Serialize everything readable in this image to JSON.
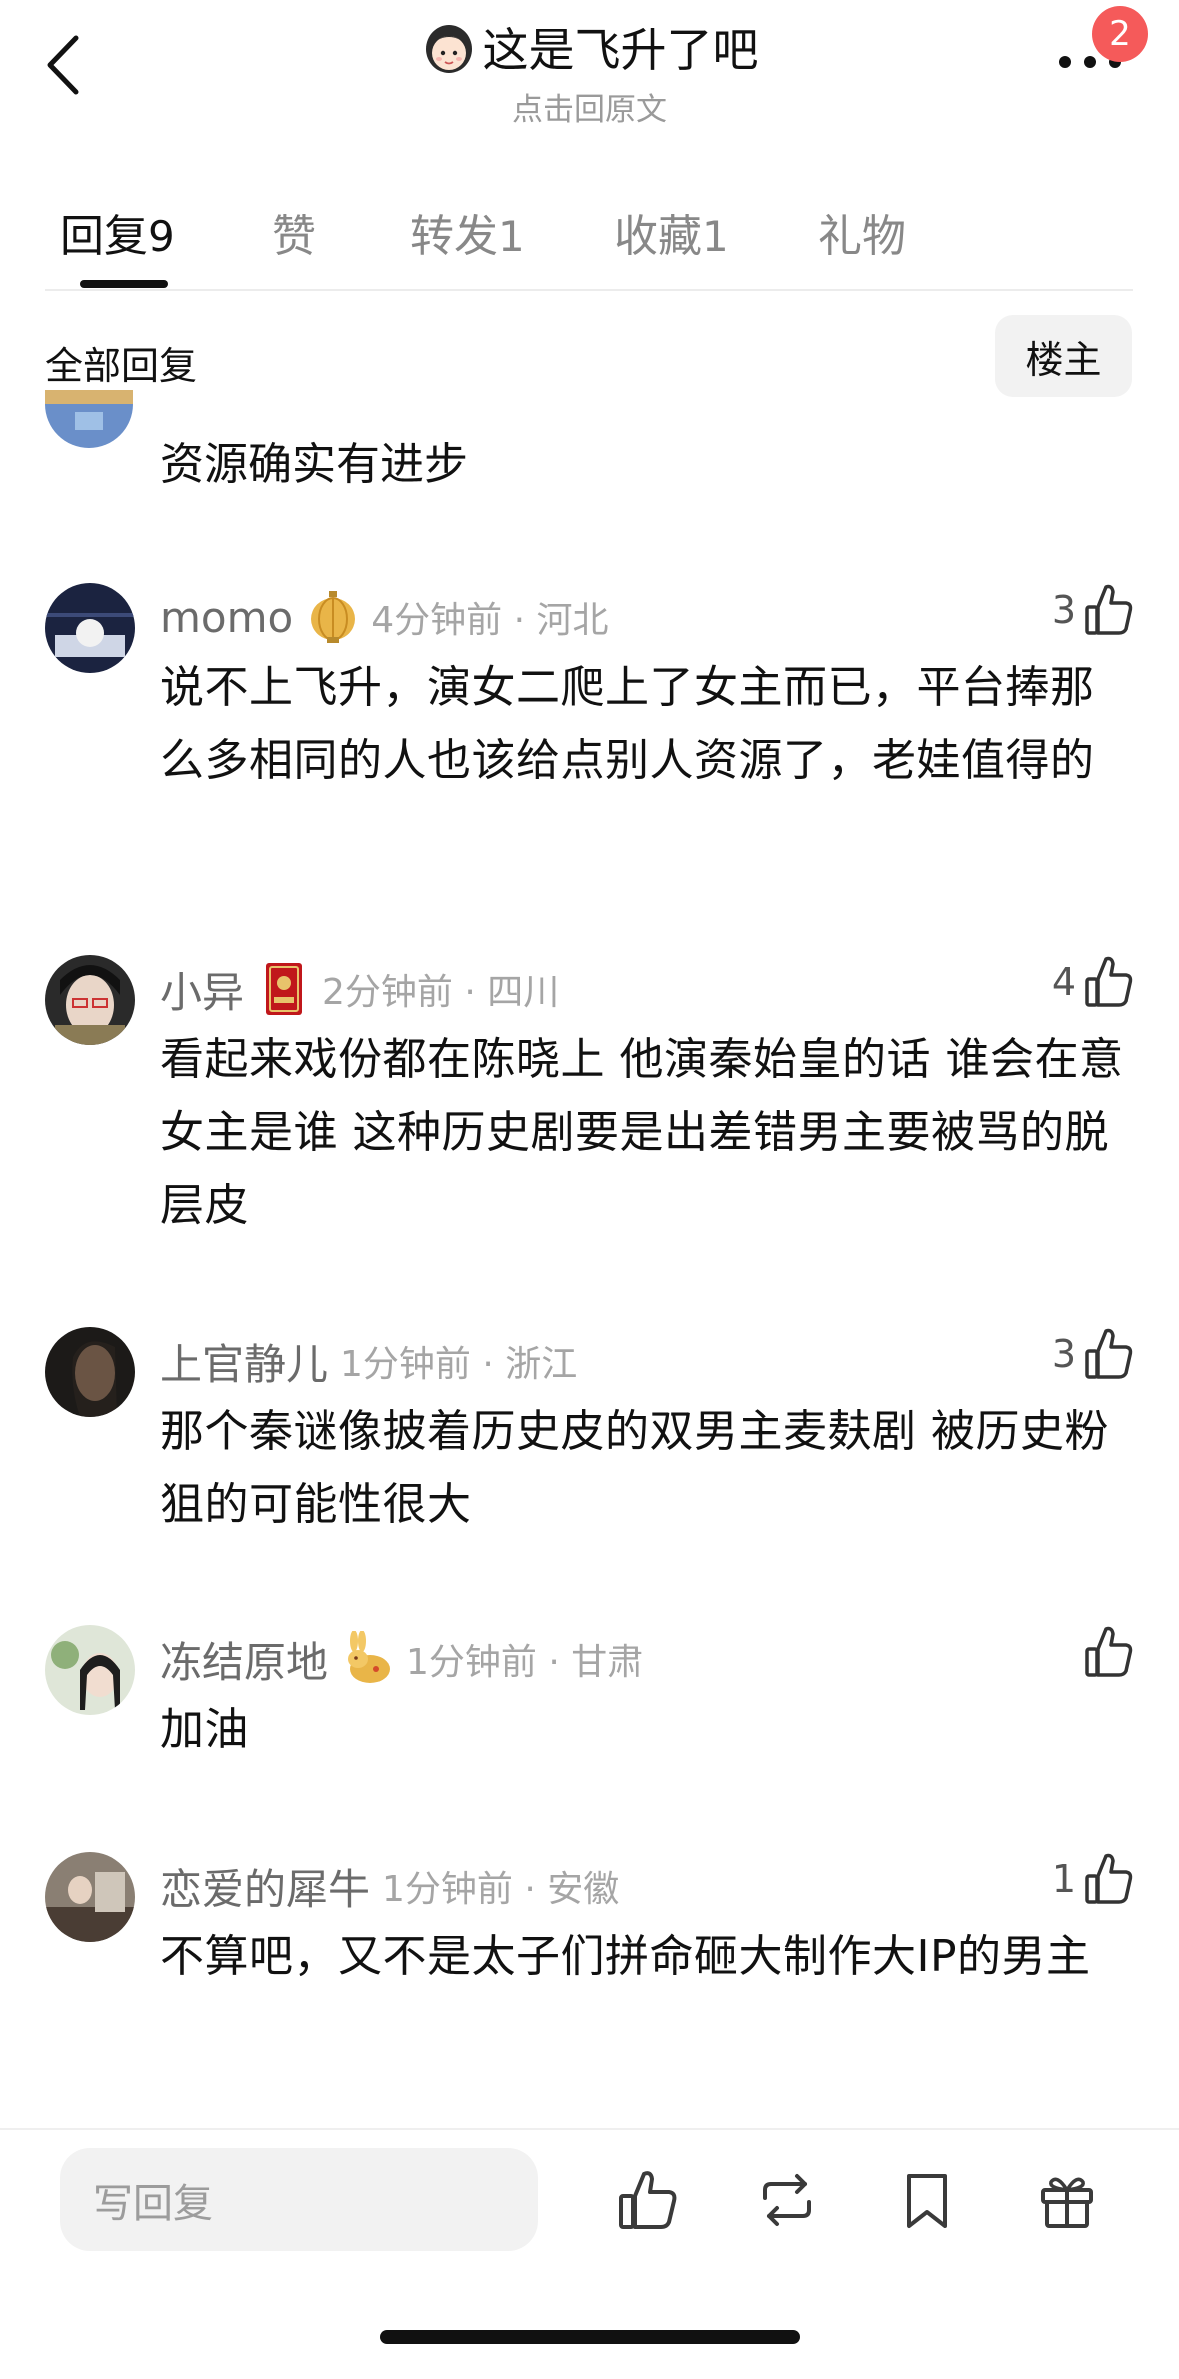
{
  "header": {
    "title": "这是飞升了吧",
    "subtitle": "点击回原文",
    "notification_count": "2"
  },
  "tabs": [
    {
      "label": "回复",
      "count": "9",
      "active": true
    },
    {
      "label": "赞",
      "count": "",
      "active": false
    },
    {
      "label": "转发",
      "count": "1",
      "active": false
    },
    {
      "label": "收藏",
      "count": "1",
      "active": false
    },
    {
      "label": "礼物",
      "count": "",
      "active": false
    }
  ],
  "section": {
    "title": "全部回复",
    "filter_label": "楼主"
  },
  "partial_comment": {
    "text": "资源确实有进步"
  },
  "comments": [
    {
      "username": "momo",
      "badge_icon": "lantern-icon",
      "time_location": "4分钟前 · 河北",
      "likes": "3",
      "text": "说不上飞升，演女二爬上了女主而已，平台捧那么多相同的人也该给点别人资源了，老娃值得的"
    },
    {
      "username": "小异",
      "badge_icon": "red-book-icon",
      "time_location": "2分钟前 · 四川",
      "likes": "4",
      "text": "看起来戏份都在陈晓上 他演秦始皇的话 谁会在意女主是谁 这种历史剧要是出差错男主要被骂的脱层皮"
    },
    {
      "username": "上官静儿",
      "badge_icon": "",
      "time_location": "1分钟前 · 浙江",
      "likes": "3",
      "text": "那个秦谜像披着历史皮的双男主麦麸剧 被历史粉狙的可能性很大"
    },
    {
      "username": "冻结原地",
      "badge_icon": "rabbit-icon",
      "time_location": "1分钟前 · 甘肃",
      "likes": "",
      "text": "加油"
    },
    {
      "username": "恋爱的犀牛",
      "badge_icon": "",
      "time_location": "1分钟前 · 安徽",
      "likes": "1",
      "text": "不算吧，又不是太子们拼命砸大制作大IP的男主"
    }
  ],
  "bottom_bar": {
    "reply_placeholder": "写回复",
    "actions": [
      "like-icon",
      "repost-icon",
      "bookmark-icon",
      "gift-icon"
    ]
  },
  "colors": {
    "badge_red": "#f55a5a",
    "muted_text": "#a5a5a5",
    "input_bg": "#f2f2f2"
  }
}
